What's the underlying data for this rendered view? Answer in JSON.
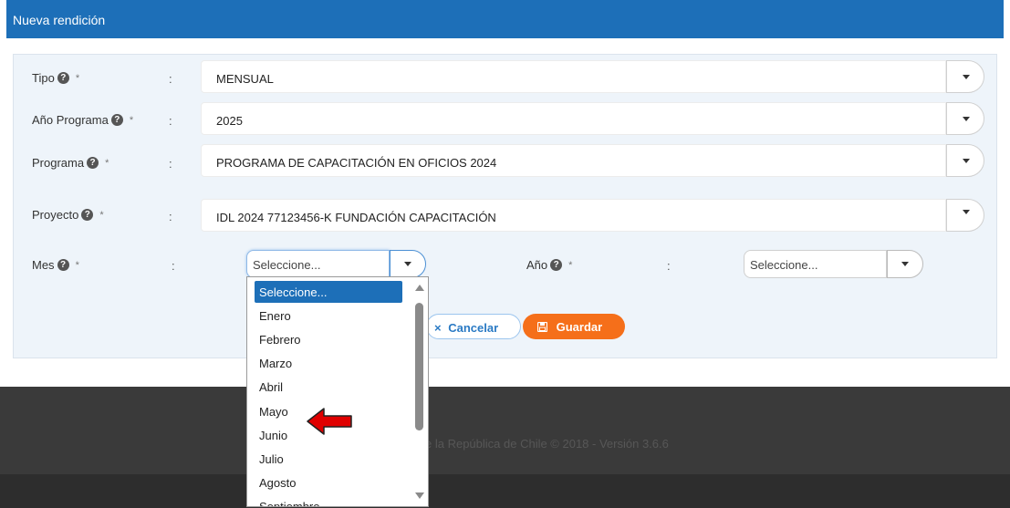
{
  "modal": {
    "title": "Nueva rendición"
  },
  "form": {
    "tipo": {
      "label": "Tipo",
      "required": "*",
      "colon": ":",
      "value": "MENSUAL"
    },
    "anio_programa": {
      "label": "Año Programa",
      "required": "*",
      "colon": ":",
      "value": "2025"
    },
    "programa": {
      "label": "Programa",
      "required": "*",
      "colon": ":",
      "value": "PROGRAMA DE CAPACITACIÓN EN OFICIOS 2024"
    },
    "proyecto": {
      "label": "Proyecto",
      "required": "*",
      "colon": ":",
      "value": "IDL 2024 77123456-K FUNDACIÓN CAPACITACIÓN"
    },
    "mes": {
      "label": "Mes",
      "required": "*",
      "colon": ":",
      "value": "Seleccione..."
    },
    "anio": {
      "label": "Año",
      "required": "*",
      "colon": ":",
      "value": "Seleccione..."
    },
    "help_icon": "?"
  },
  "buttons": {
    "cancel": {
      "icon": "×",
      "label": "Cancelar"
    },
    "save": {
      "icon": "save-icon",
      "label": "Guardar"
    }
  },
  "dropdown": {
    "options": [
      "Seleccione...",
      "Enero",
      "Febrero",
      "Marzo",
      "Abril",
      "Mayo",
      "Junio",
      "Julio",
      "Agosto",
      "Septiembre"
    ],
    "highlighted": "Seleccione..."
  },
  "footer": {
    "text": "e la República de Chile © 2018 - Versión 3.6.6"
  },
  "colors": {
    "header": "#1d6fb8",
    "save": "#f56f1a",
    "annotation_arrow": "#e00000"
  }
}
